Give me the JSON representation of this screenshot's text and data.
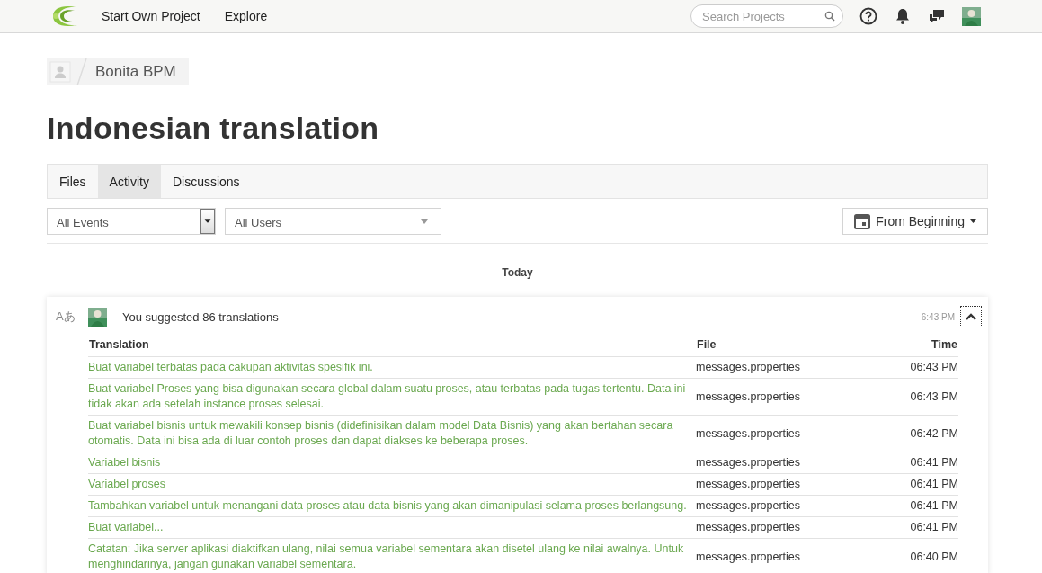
{
  "nav": {
    "links": [
      "Start Own Project",
      "Explore"
    ],
    "search": {
      "placeholder": "Search Projects"
    }
  },
  "breadcrumb": {
    "project": "Bonita BPM"
  },
  "title": "Indonesian translation",
  "tabs": [
    {
      "label": "Files",
      "selected": false
    },
    {
      "label": "Activity",
      "selected": true
    },
    {
      "label": "Discussions",
      "selected": false
    }
  ],
  "filters": [
    {
      "label": "All Events",
      "kind": "native"
    },
    {
      "label": "All Users",
      "kind": "custom"
    }
  ],
  "date_filter": "From Beginning",
  "day": "Today",
  "activity": {
    "type_icon": "Aあ",
    "summary": "You suggested 86 translations",
    "time": "6:43 PM",
    "expanded": true,
    "columns": [
      "Translation",
      "File",
      "Time"
    ],
    "rows": [
      {
        "translation": "Buat variabel terbatas pada cakupan aktivitas spesifik ini.",
        "file": "messages.properties",
        "time": "06:43 PM"
      },
      {
        "translation": "Buat variabel Proses yang bisa digunakan secara global dalam suatu proses, atau terbatas pada tugas tertentu. Data ini tidak akan ada setelah instance proses selesai.",
        "file": "messages.properties",
        "time": "06:43 PM"
      },
      {
        "translation": "Buat variabel bisnis untuk mewakili konsep bisnis (didefinisikan dalam model Data Bisnis) yang akan bertahan secara otomatis. Data ini bisa ada di luar contoh proses dan dapat diakses ke beberapa proses.",
        "file": "messages.properties",
        "time": "06:42 PM"
      },
      {
        "translation": "Variabel bisnis",
        "file": "messages.properties",
        "time": "06:41 PM"
      },
      {
        "translation": "Variabel proses",
        "file": "messages.properties",
        "time": "06:41 PM"
      },
      {
        "translation": "Tambahkan variabel untuk menangani data proses atau data bisnis yang akan dimanipulasi selama proses berlangsung.",
        "file": "messages.properties",
        "time": "06:41 PM"
      },
      {
        "translation": "Buat variabel...",
        "file": "messages.properties",
        "time": "06:41 PM"
      },
      {
        "translation": "Catatan: Jika server aplikasi diaktifkan ulang, nilai semua variabel sementara akan disetel ulang ke nilai awalnya. Untuk menghindarinya, jangan gunakan variabel sementara.",
        "file": "messages.properties",
        "time": "06:40 PM"
      }
    ]
  }
}
